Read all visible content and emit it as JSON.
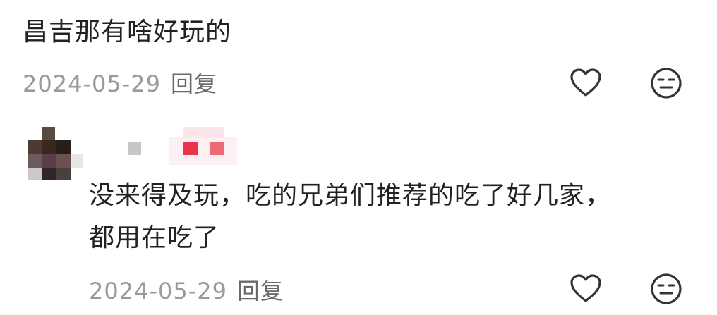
{
  "comments": [
    {
      "text": "昌吉那有啥好玩的",
      "date": "2024-05-29",
      "reply_label": "回复"
    },
    {
      "text_line1": "没来得及玩，吃的兄弟们推荐的吃了好几家，",
      "text_line2": "都用在吃了",
      "date": "2024-05-29",
      "reply_label": "回复"
    }
  ],
  "icons": {
    "like": "heart-outline-icon",
    "dislike": "neutral-face-icon"
  },
  "colors": {
    "text": "#222222",
    "meta": "#9a9a9a",
    "icon": "#333333",
    "badge_red": "#e8334a"
  }
}
